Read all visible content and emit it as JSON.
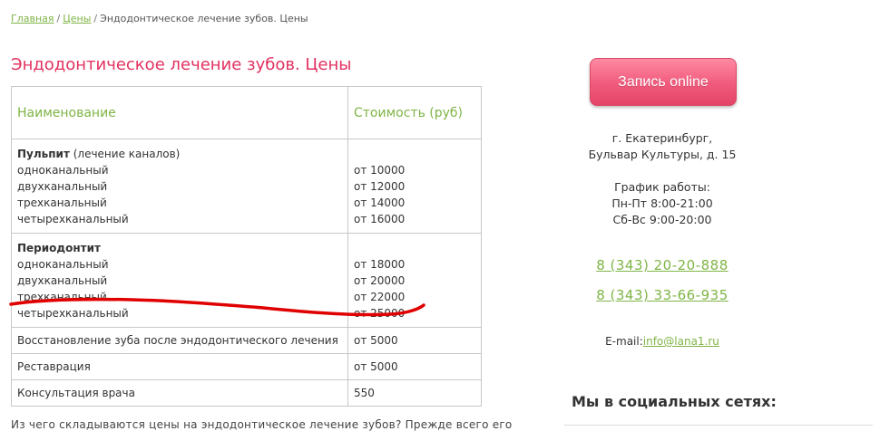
{
  "breadcrumb": {
    "home": "Главная",
    "prices": "Цены",
    "current": "Эндодонтическое лечение зубов. Цены",
    "separator": "/"
  },
  "page_title": "Эндодонтическое лечение зубов. Цены",
  "table": {
    "headers": [
      "Наименование",
      "Стоимость (руб)"
    ],
    "pulpitis": {
      "title": "Пульпит",
      "subtitle": " (лечение каналов)",
      "items": [
        {
          "name": "одноканальный",
          "price": "от 10000"
        },
        {
          "name": "двухканальный",
          "price": "от 12000"
        },
        {
          "name": "трехканальный",
          "price": "от 14000"
        },
        {
          "name": "четырехканальный",
          "price": "от 16000"
        }
      ]
    },
    "periodontitis": {
      "title": "Периодонтит",
      "items": [
        {
          "name": "одноканальный",
          "price": "от 18000"
        },
        {
          "name": "двухканальный",
          "price": "от 20000"
        },
        {
          "name": "трехканальный",
          "price": "от 22000"
        },
        {
          "name": "четырехканальный",
          "price": "от 25000"
        }
      ]
    },
    "rows": [
      {
        "name": "Восстановление зуба после эндодонтического лечения",
        "price": "от 5000"
      },
      {
        "name": "Реставрация",
        "price": "от 5000"
      },
      {
        "name": "Консультация врача",
        "price": "550"
      }
    ]
  },
  "footer_text": "Из чего складываются цены на эндодонтическое лечение зубов? Прежде всего его",
  "sidebar": {
    "cta_label": "Запись online",
    "address_line1": "г. Екатеринбург,",
    "address_line2": "Бульвар Культуры, д. 15",
    "schedule_title": "График работы:",
    "schedule_weekdays": "Пн-Пт 8:00-21:00",
    "schedule_weekend": "Сб-Вс 9:00-20:00",
    "phone1": "8 (343) 20-20-888",
    "phone2": "8 (343) 33-66-935",
    "email_label": "E-mail:",
    "email": "info@lana1.ru",
    "social_title": "Мы в социальных сетях:"
  },
  "colors": {
    "accent_green": "#7fb446",
    "title_pink": "#e2315f",
    "button_pink": "#f05a7c",
    "annotation_red": "#e00000"
  }
}
